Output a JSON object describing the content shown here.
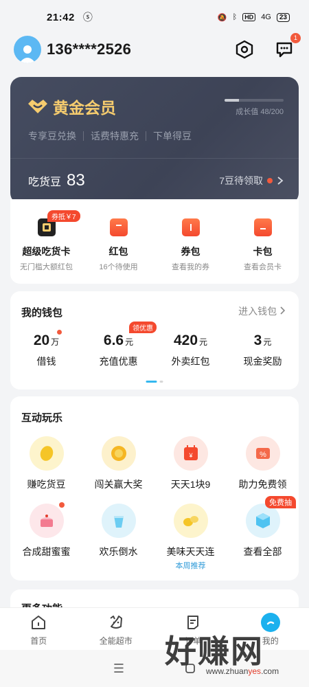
{
  "status_bar": {
    "time": "21:42",
    "signal": "4G",
    "hd": "HD",
    "battery": "23"
  },
  "header": {
    "phone": "136****2526",
    "message_badge": "1"
  },
  "vip": {
    "title": "黄金会员",
    "growth_text": "成长值 48/200",
    "growth_fraction": 0.24,
    "perks": [
      "专享豆兑换",
      "话费特惠充",
      "下单得豆"
    ],
    "beans_label": "吃货豆",
    "beans_value": "83",
    "beans_pending": "7豆待领取"
  },
  "quick": [
    {
      "title": "超级吃货卡",
      "sub": "无门槛大额红包",
      "tag": "券抵￥7"
    },
    {
      "title": "红包",
      "sub": "16个待使用"
    },
    {
      "title": "券包",
      "sub": "查看我的券"
    },
    {
      "title": "卡包",
      "sub": "查看会员卡"
    }
  ],
  "wallet": {
    "title": "我的钱包",
    "link": "进入钱包",
    "items": [
      {
        "value": "20",
        "unit": "万",
        "label": "借钱"
      },
      {
        "value": "6.6",
        "unit": "元",
        "label": "充值优惠",
        "tag": "领优惠"
      },
      {
        "value": "420",
        "unit": "元",
        "label": "外卖红包"
      },
      {
        "value": "3",
        "unit": "元",
        "label": "现金奖励"
      }
    ]
  },
  "play": {
    "title": "互动玩乐",
    "items": [
      {
        "label": "赚吃货豆"
      },
      {
        "label": "闯关赢大奖"
      },
      {
        "label": "天天1块9"
      },
      {
        "label": "助力免费领"
      },
      {
        "label": "合成甜蜜蜜"
      },
      {
        "label": "欢乐倒水"
      },
      {
        "label": "美味天天连",
        "sub": "本周推荐"
      },
      {
        "label": "查看全部",
        "tag": "免费抽"
      }
    ]
  },
  "more": {
    "title": "更多功能"
  },
  "tabs": [
    {
      "label": "首页"
    },
    {
      "label": "全能超市"
    },
    {
      "label": "订单"
    },
    {
      "label": "我的"
    }
  ],
  "watermark": {
    "cn": "好赚网",
    "en_prefix": "zhuan",
    "en_highlight": "yes",
    "en_suffix": ".com"
  },
  "colors": {
    "accent_red": "#f4492e",
    "brand_blue": "#1cb1ee",
    "vip_gold": "#f6cc6e",
    "vip_bg": "#454c60"
  },
  "icons": [
    "hexagon-settings-icon",
    "message-icon",
    "chevron-right-icon",
    "home-icon",
    "shop-icon",
    "order-icon",
    "profile-icon"
  ]
}
